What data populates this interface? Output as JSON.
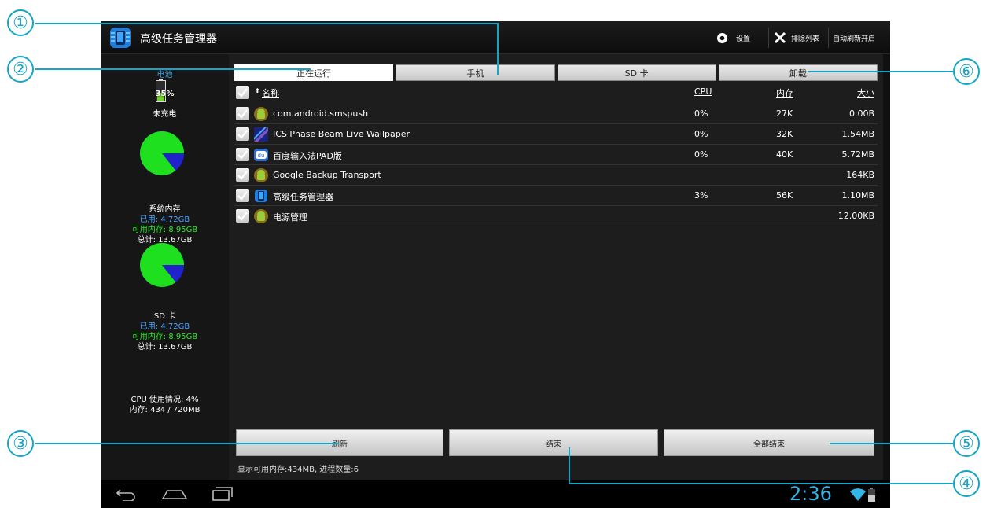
{
  "app": {
    "title": "高级任务管理器",
    "settings_label": "设置",
    "exclude_label": "排除列表",
    "autorefresh_label": "自动刷新开启"
  },
  "left_panel": {
    "battery_title": "电池",
    "battery_percent": "35%",
    "battery_state": "未充电",
    "sys_mem": {
      "title": "系统内存",
      "used": "已用: 4.72GB",
      "available": "可用内存: 8.95GB",
      "total": "总计: 13.67GB"
    },
    "sd": {
      "title": "SD 卡",
      "used": "已用: 4.72GB",
      "available": "可用内存: 8.95GB",
      "total": "总计: 13.67GB"
    },
    "cpu_usage": "CPU 使用情况: 4%",
    "memory": "内存: 434 / 720MB"
  },
  "tabs": [
    {
      "label": "正在运行"
    },
    {
      "label": "手机"
    },
    {
      "label": "SD 卡"
    },
    {
      "label": "卸载"
    }
  ],
  "list_header": {
    "name": "名称",
    "sort_arrow": "⬆",
    "cpu": "CPU",
    "mem": "内存",
    "size": "大小"
  },
  "processes": [
    {
      "name": "com.android.smspush",
      "cpu": "0%",
      "mem": "27K",
      "size": "0.00B",
      "icon": "android-icon"
    },
    {
      "name": "ICS Phase Beam Live Wallpaper",
      "cpu": "0%",
      "mem": "32K",
      "size": "1.54MB",
      "icon": "wallpaper-icon"
    },
    {
      "name": "百度输入法PAD版",
      "cpu": "0%",
      "mem": "40K",
      "size": "5.72MB",
      "icon": "baidu-input-icon"
    },
    {
      "name": "Google Backup Transport",
      "cpu": "",
      "mem": "",
      "size": "164KB",
      "icon": "android-icon"
    },
    {
      "name": "高级任务管理器",
      "cpu": "3%",
      "mem": "56K",
      "size": "1.10MB",
      "icon": "task-manager-icon"
    },
    {
      "name": "电源管理",
      "cpu": "",
      "mem": "",
      "size": "12.00KB",
      "icon": "android-icon"
    }
  ],
  "buttons": {
    "refresh": "刷新",
    "end": "结束",
    "end_all": "全部结束"
  },
  "status": "显示可用内存:434MB, 进程数量:6",
  "clock": "2:36",
  "callouts": [
    "①",
    "②",
    "③",
    "④",
    "⑤",
    "⑥"
  ],
  "colors": {
    "accent": "#14a5c6",
    "used_blue": "#4aa3ff",
    "free_green": "#2ee62e",
    "pie_green": "#1fe01f",
    "pie_blue": "#2222cc"
  }
}
